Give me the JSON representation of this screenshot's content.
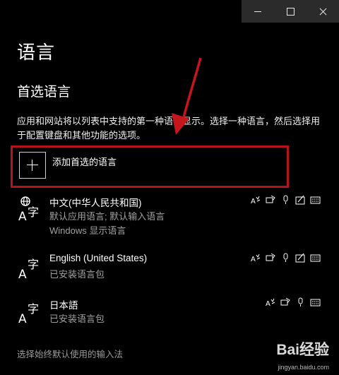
{
  "page": {
    "title": "语言",
    "section_title": "首选语言",
    "description": "应用和网站将以列表中支持的第一种语言显示。选择一种语言，然后选择用于配置键盘和其他功能的选项。"
  },
  "add_language": {
    "label": "添加首选的语言"
  },
  "languages": [
    {
      "name": "中文(中华人民共和国)",
      "line1": "默认应用语言; 默认输入语言",
      "line2": "Windows 显示语言"
    },
    {
      "name": "English (United States)",
      "line1": "已安装语言包"
    },
    {
      "name": "日本語",
      "line1": "已安装语言包"
    }
  ],
  "footer": {
    "link": "选择始终默认使用的输入法"
  },
  "icons": {
    "window_controls": [
      "minimize-icon",
      "maximize-icon",
      "close-icon"
    ],
    "language": "language-icon",
    "display_language": "globe-icon",
    "features": [
      "text-to-speech-icon",
      "speech-recognition-icon",
      "microphone-icon",
      "handwriting-icon",
      "keyboard-icon"
    ]
  },
  "colors": {
    "highlight": "#b5141c",
    "background": "#000000",
    "secondary_text": "#a0a0a0"
  },
  "watermark": {
    "brand": "Bai",
    "suffix": "经验",
    "url": "jingyan.baidu.com"
  }
}
